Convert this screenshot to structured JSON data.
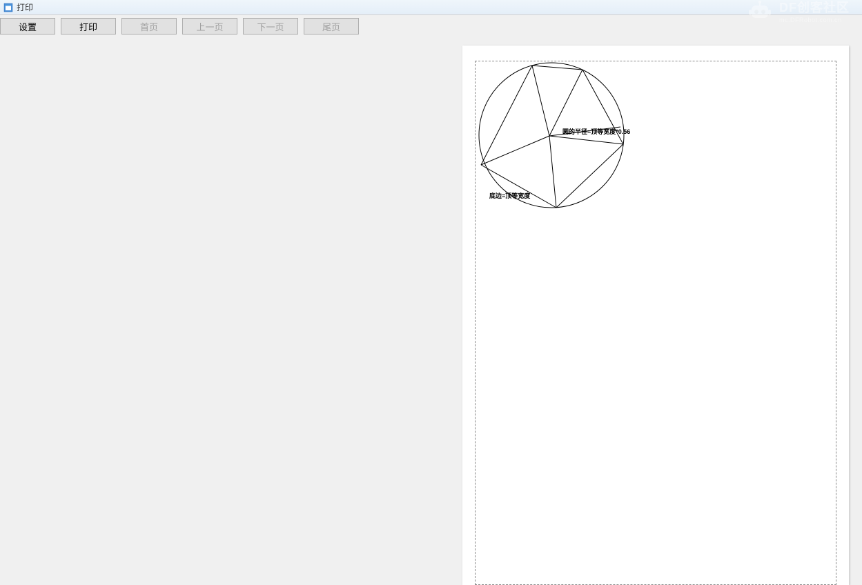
{
  "window": {
    "title": "打印"
  },
  "toolbar": {
    "settings_label": "设置",
    "print_label": "打印",
    "first_page_label": "首页",
    "prev_page_label": "上一页",
    "next_page_label": "下一页",
    "last_page_label": "尾页"
  },
  "preview": {
    "annotations": {
      "radius_label": "圆的半径=顶等宽度*0.56",
      "side_label": "底边=顶等宽度"
    }
  },
  "watermark": {
    "title": "DF创客社区",
    "subtitle": "mc.DFRobot.com.cn"
  }
}
